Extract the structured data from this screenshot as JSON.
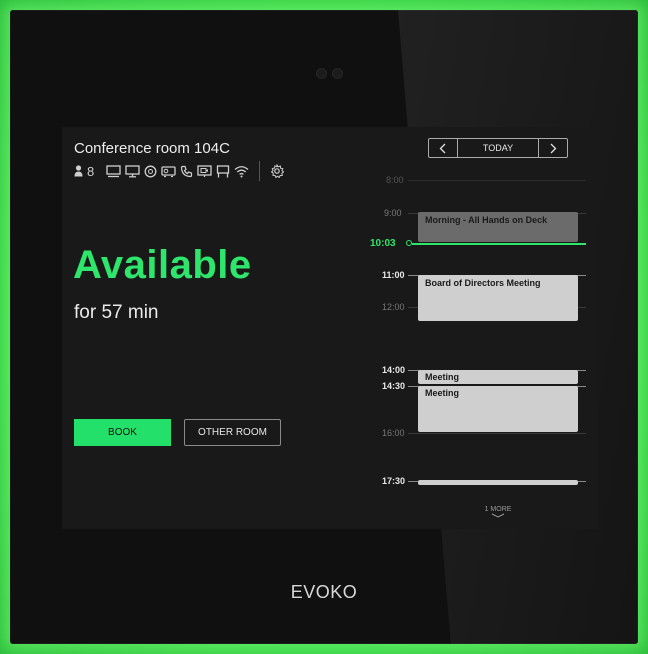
{
  "room": {
    "name": "Conference room 104C",
    "capacity": "8"
  },
  "status": {
    "label": "Available",
    "duration": "for 57 min",
    "color": "#2ee66b"
  },
  "actions": {
    "book_label": "BOOK",
    "other_room_label": "OTHER ROOM"
  },
  "calendar": {
    "today_label": "TODAY",
    "prev_icon": "chevron-left-icon",
    "next_icon": "chevron-right-icon",
    "hours": [
      "8:00",
      "9:00",
      "11:00",
      "12:00",
      "14:00",
      "14:30",
      "16:00",
      "17:30"
    ],
    "now": "10:03",
    "events": [
      {
        "title": "Morning - All Hands on Deck"
      },
      {
        "title": "Board of Directors Meeting"
      },
      {
        "title": "Meeting"
      },
      {
        "title": "Meeting"
      },
      {
        "title": ""
      }
    ],
    "more_label": "1 MORE"
  },
  "amenity_icons": [
    "person-icon",
    "display-icon",
    "monitor-icon",
    "coffee-icon",
    "projector-icon",
    "phone-icon",
    "video-conference-icon",
    "whiteboard-icon",
    "wifi-icon",
    "settings-icon"
  ],
  "brand": "EVOKO"
}
